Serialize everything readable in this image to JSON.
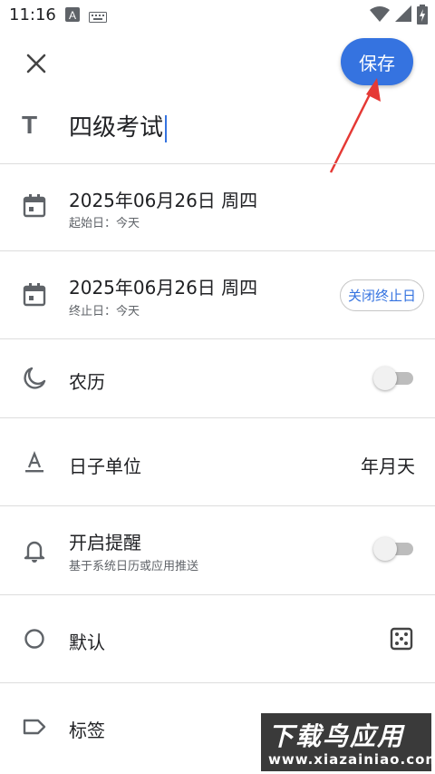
{
  "status_bar": {
    "time": "11:16"
  },
  "toolbar": {
    "save_label": "保存"
  },
  "title": {
    "value": "四级考试"
  },
  "start_date": {
    "date": "2025年06月26日 周四",
    "sub": "起始日：今天"
  },
  "end_date": {
    "date": "2025年06月26日 周四",
    "sub": "终止日：今天",
    "chip": "关闭终止日"
  },
  "lunar": {
    "label": "农历",
    "enabled": false
  },
  "day_unit": {
    "label": "日子单位",
    "value": "年月天"
  },
  "reminder": {
    "label": "开启提醒",
    "sub": "基于系统日历或应用推送",
    "enabled": false
  },
  "default": {
    "label": "默认"
  },
  "tags": {
    "label": "标签"
  },
  "watermark": {
    "brand": "下载鸟应用",
    "url": "www.xiazainiao.com"
  },
  "colors": {
    "accent": "#3573e0",
    "annotation_arrow": "#e53935"
  }
}
